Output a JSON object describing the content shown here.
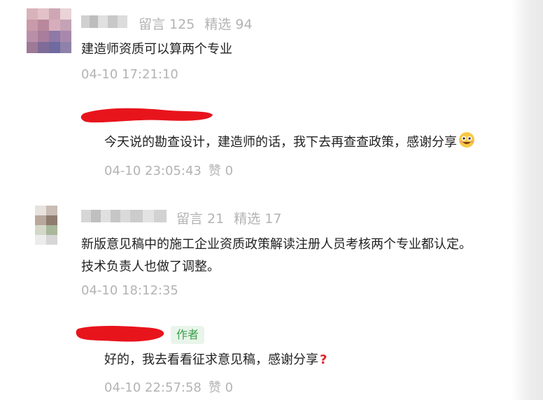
{
  "colors": {
    "text": "#222222",
    "muted": "#b3b3b3",
    "redaction": "#e8141c",
    "author_badge_text": "#3a9f4c",
    "author_badge_bg": "#e9f5ea"
  },
  "comments": [
    {
      "user": {
        "name": "",
        "stats": {
          "messages_label": "留言 125",
          "featured_label": "精选 94"
        }
      },
      "text": "建造师资质可以算两个专业",
      "timestamp": "04-10 17:21:10",
      "reply": {
        "text": "今天说的勘查设计，建造师的话，我下去再查查政策，感谢分享",
        "emoji_icon": "grinning-face-emoji-icon",
        "timestamp": "04-10 23:05:43",
        "like_label": "赞 0"
      }
    },
    {
      "user": {
        "name": "",
        "stats": {
          "messages_label": "留言 21",
          "featured_label": "精选 17"
        }
      },
      "text_lines": [
        "新版意见稿中的施工企业资质政策解读注册人员考核两个专业都认定。",
        "技术负责人也做了调整。"
      ],
      "timestamp": "04-10 18:12:35",
      "reply": {
        "author_badge": "作者",
        "text": "好的，我去看看征求意见稿，感谢分享",
        "emoji_icon": "red-question-mark-icon",
        "timestamp": "04-10 22:57:58",
        "like_label": "赞 0"
      }
    }
  ]
}
